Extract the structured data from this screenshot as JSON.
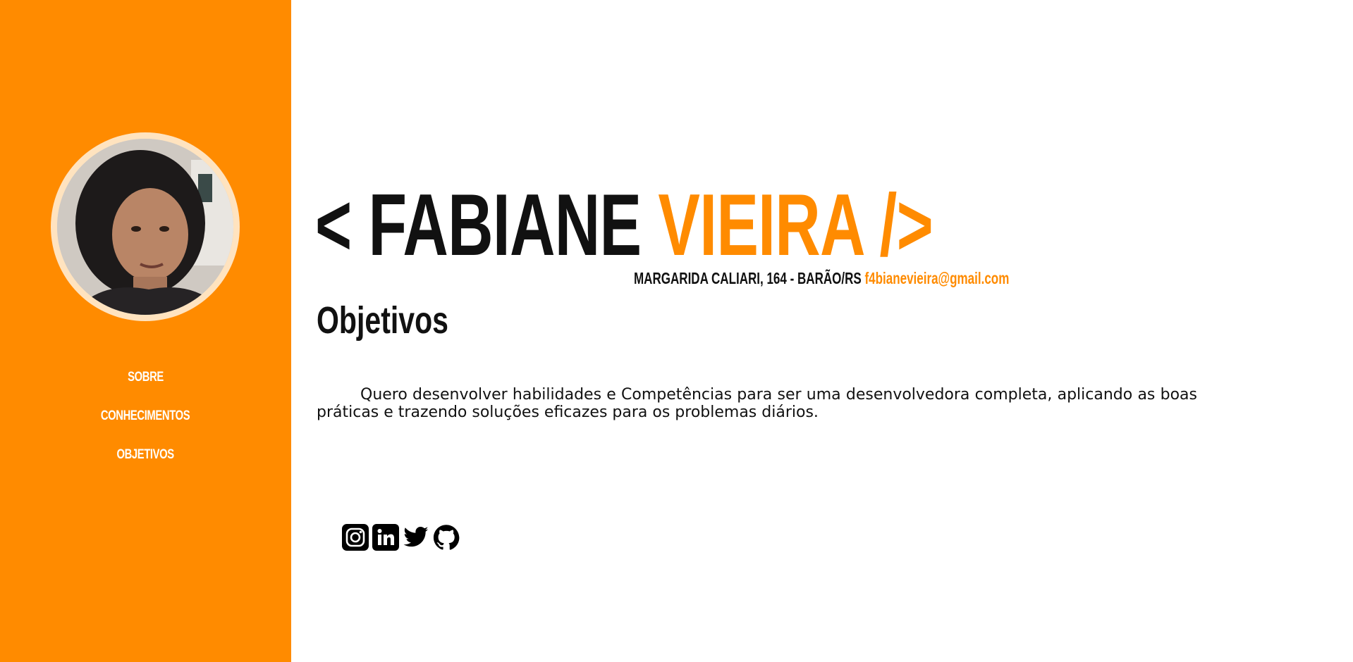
{
  "sidebar": {
    "nav": [
      {
        "label": "SOBRE"
      },
      {
        "label": "CONHECIMENTOS"
      },
      {
        "label": "OBJETIVOS"
      }
    ],
    "accent_color": "#ff8b00"
  },
  "header": {
    "name_prefix": "< FABIANE",
    "name_accent": "VIEIRA />",
    "address": "MARGARIDA CALIARI, 164 - BARÃO/RS",
    "email": "f4bianevieira@gmail.com"
  },
  "objetivos": {
    "title": "Objetivos",
    "text": "Quero desenvolver habilidades e Competências para ser uma desenvolvedora completa, aplicando as boas práticas e trazendo soluções eficazes para os problemas diários."
  },
  "social": [
    {
      "icon": "instagram-icon"
    },
    {
      "icon": "linkedin-icon"
    },
    {
      "icon": "twitter-icon"
    },
    {
      "icon": "github-icon"
    }
  ]
}
